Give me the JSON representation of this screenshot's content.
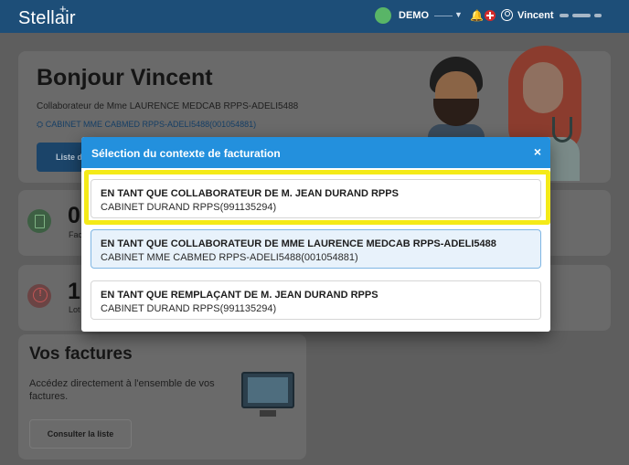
{
  "app": {
    "brand": "Stellair",
    "brand_mark": "+"
  },
  "topbar": {
    "env_label": "DEMO",
    "user_name": "Vincent",
    "icons": [
      "status-dot-icon",
      "bell-icon",
      "red-cross-icon",
      "user-icon"
    ]
  },
  "dashboard": {
    "greeting": "Bonjour Vincent",
    "role_line": "Collaborateur de Mme LAURENCE MEDCAB RPPS-ADELI5488",
    "cabinet_line": "CABINET MME CABMED RPPS-ADELI5488(001054881)",
    "list_button": "Liste d",
    "stats": [
      {
        "value": "0",
        "label": "Fac"
      },
      {
        "value": "1",
        "label": "Lot"
      }
    ],
    "invoices": {
      "title": "Vos factures",
      "description": "Accédez directement à l'ensemble de vos factures.",
      "button": "Consulter la liste"
    }
  },
  "modal": {
    "title": "Sélection du contexte de facturation",
    "close": "×",
    "options": [
      {
        "line1": "EN TANT QUE COLLABORATEUR DE M. JEAN DURAND RPPS",
        "line2": "CABINET DURAND RPPS(991135294)",
        "selected": false,
        "highlighted": true
      },
      {
        "line1": "EN TANT QUE COLLABORATEUR DE MME LAURENCE MEDCAB RPPS-ADELI5488",
        "line2": "CABINET MME CABMED RPPS-ADELI5488(001054881)",
        "selected": true,
        "highlighted": false
      },
      {
        "line1": "EN TANT QUE REMPLAÇANT DE M. JEAN DURAND RPPS",
        "line2": "CABINET DURAND RPPS(991135294)",
        "selected": false,
        "highlighted": false
      }
    ]
  },
  "colors": {
    "topbar": "#1d4e78",
    "modal_header": "#2390dd",
    "highlight": "#f4ea18",
    "selected_bg": "#e8f2fb",
    "status_dot": "#59b567"
  }
}
